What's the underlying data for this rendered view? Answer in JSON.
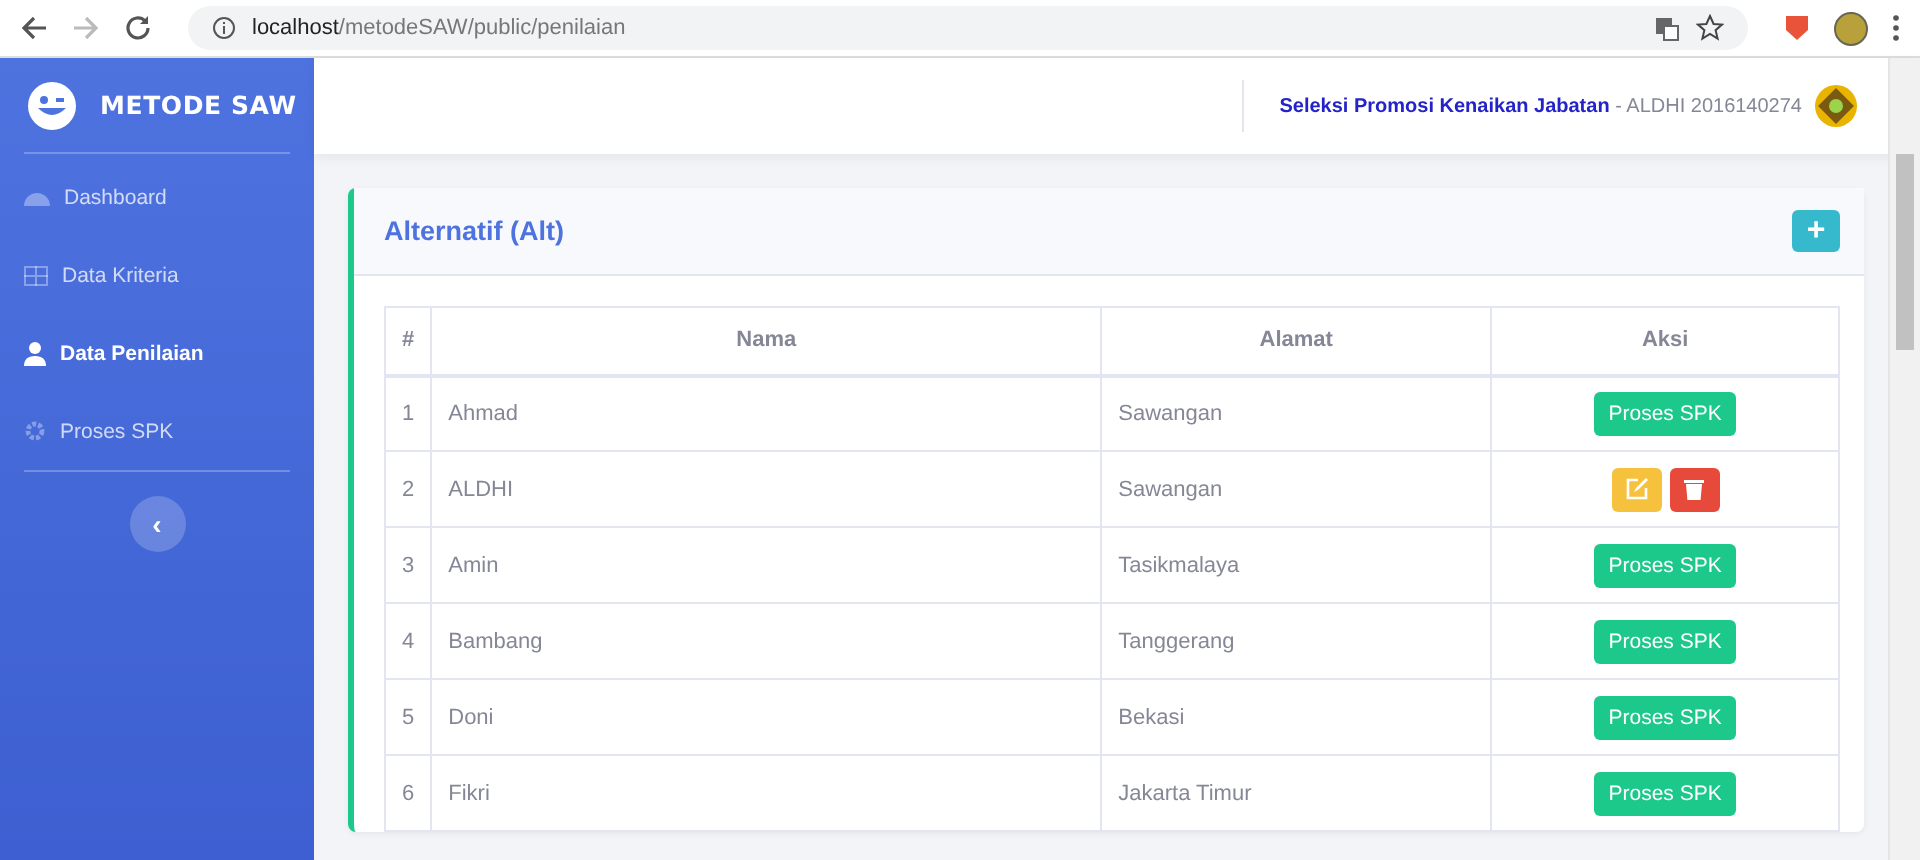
{
  "browser": {
    "url_host": "localhost",
    "url_path": "/metodeSAW/public/penilaian"
  },
  "sidebar": {
    "brand": "METODE SAW",
    "items": [
      {
        "label": "Dashboard",
        "kind": "gauge",
        "selected": false
      },
      {
        "label": "Data Kriteria",
        "kind": "table",
        "selected": false
      },
      {
        "label": "Data Penilaian",
        "kind": "user",
        "selected": true
      },
      {
        "label": "Proses SPK",
        "kind": "gear",
        "selected": false
      }
    ],
    "toggle": "‹"
  },
  "topbar": {
    "title": "Seleksi Promosi Kenaikan Jabatan",
    "user": " - ALDHI 2016140274"
  },
  "card": {
    "title": "Alternatif (Alt)",
    "add": "+",
    "table": {
      "columns": [
        "#",
        "Nama",
        "Alamat",
        "Aksi"
      ],
      "rows": [
        {
          "no": "1",
          "nama": "Ahmad",
          "alamat": "Sawangan",
          "kind": "process",
          "action": "Proses SPK"
        },
        {
          "no": "2",
          "nama": "ALDHI",
          "alamat": "Sawangan",
          "kind": "edit_delete"
        },
        {
          "no": "3",
          "nama": "Amin",
          "alamat": "Tasikmalaya",
          "kind": "process",
          "action": "Proses SPK"
        },
        {
          "no": "4",
          "nama": "Bambang",
          "alamat": "Tanggerang",
          "kind": "process",
          "action": "Proses SPK"
        },
        {
          "no": "5",
          "nama": "Doni",
          "alamat": "Bekasi",
          "kind": "process",
          "action": "Proses SPK"
        },
        {
          "no": "6",
          "nama": "Fikri",
          "alamat": "Jakarta Timur",
          "kind": "process",
          "action": "Proses SPK"
        }
      ]
    }
  }
}
